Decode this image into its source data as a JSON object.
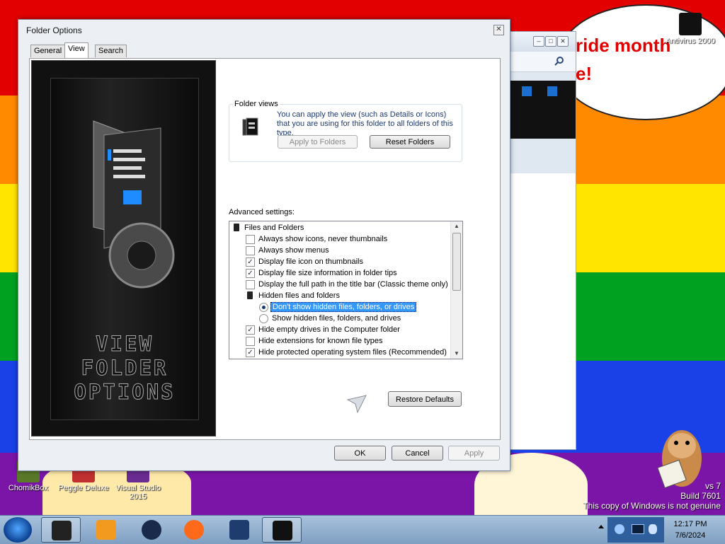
{
  "desktop": {
    "banner_line1": "ride month",
    "banner_line2": "e!",
    "icons": [
      {
        "label": "ChomikBox"
      },
      {
        "label": "Peggle Deluxe"
      },
      {
        "label": "Visual Studio 2015"
      },
      {
        "label": "Antivirus 2000"
      }
    ],
    "watermark": {
      "version": "vs 7",
      "build": "Build 7601",
      "genuine": "This copy of Windows is not genuine"
    }
  },
  "dialog": {
    "title": "Folder Options",
    "close_glyph": "✕",
    "tabs": [
      {
        "label": "General"
      },
      {
        "label": "View"
      },
      {
        "label": "Search"
      }
    ],
    "art_text": [
      "VIEW",
      "FOLDER",
      "OPTIONS"
    ],
    "folder_views": {
      "title": "Folder views",
      "description": "You can apply the view (such as Details or Icons) that you are using for this folder to all folders of this type.",
      "apply_button": "Apply to Folders",
      "reset_button": "Reset Folders"
    },
    "advanced": {
      "label": "Advanced settings:",
      "items": [
        {
          "kind": "folder",
          "text": "Files and Folders"
        },
        {
          "kind": "checkbox",
          "checked": false,
          "text": "Always show icons, never thumbnails"
        },
        {
          "kind": "checkbox",
          "checked": false,
          "text": "Always show menus"
        },
        {
          "kind": "checkbox",
          "checked": true,
          "text": "Display file icon on thumbnails"
        },
        {
          "kind": "checkbox",
          "checked": true,
          "text": "Display file size information in folder tips"
        },
        {
          "kind": "checkbox",
          "checked": false,
          "text": "Display the full path in the title bar (Classic theme only)"
        },
        {
          "kind": "folder",
          "text": "Hidden files and folders"
        },
        {
          "kind": "radio",
          "checked": true,
          "selected": true,
          "text": "Don't show hidden files, folders, or drives"
        },
        {
          "kind": "radio",
          "checked": false,
          "text": "Show hidden files, folders, and drives"
        },
        {
          "kind": "checkbox",
          "checked": true,
          "text": "Hide empty drives in the Computer folder"
        },
        {
          "kind": "checkbox",
          "checked": false,
          "text": "Hide extensions for known file types"
        },
        {
          "kind": "checkbox",
          "checked": true,
          "text": "Hide protected operating system files (Recommended)"
        }
      ]
    },
    "restore_button": "Restore Defaults",
    "ok_button": "OK",
    "cancel_button": "Cancel",
    "apply_button": "Apply"
  },
  "taskbar": {
    "time": "12:17 PM",
    "date": "7/6/2024"
  }
}
